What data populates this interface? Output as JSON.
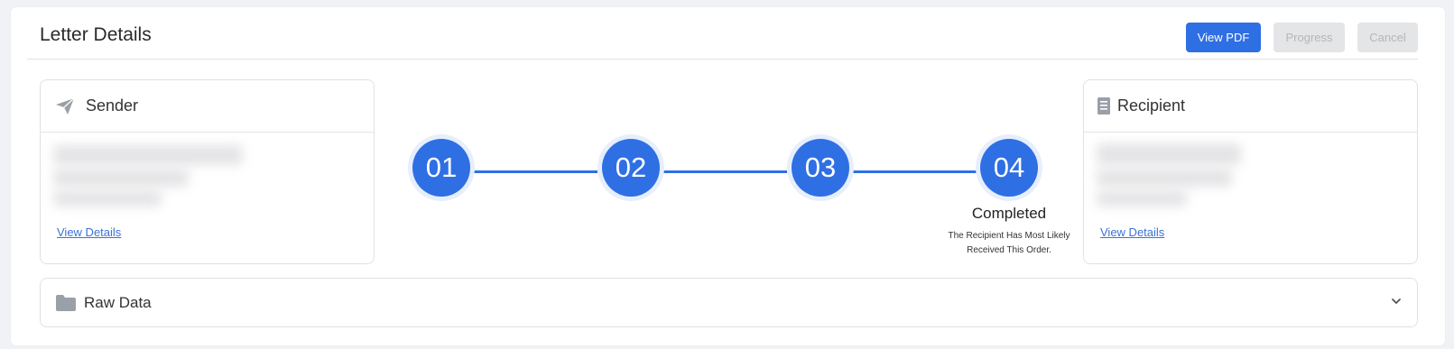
{
  "header": {
    "title": "Letter Details",
    "buttons": {
      "view_pdf": "View PDF",
      "progress": "Progress",
      "cancel": "Cancel"
    }
  },
  "sender": {
    "title": "Sender",
    "icon": "paper-plane-icon",
    "link": "View Details"
  },
  "recipient": {
    "title": "Recipient",
    "icon": "document-icon",
    "link": "View Details"
  },
  "steps": {
    "items": [
      "01",
      "02",
      "03",
      "04"
    ],
    "current_status": "Completed",
    "current_description_line1": "The Recipient Has Most Likely",
    "current_description_line2": "Received This Order."
  },
  "raw_data": {
    "title": "Raw Data",
    "icon": "folder-icon",
    "toggle_icon": "chevron-down-icon"
  },
  "colors": {
    "accent": "#2f6fe4",
    "link": "#3a73d8",
    "disabled_bg": "#e4e5e7",
    "icon_gray": "#9aa0a8"
  }
}
